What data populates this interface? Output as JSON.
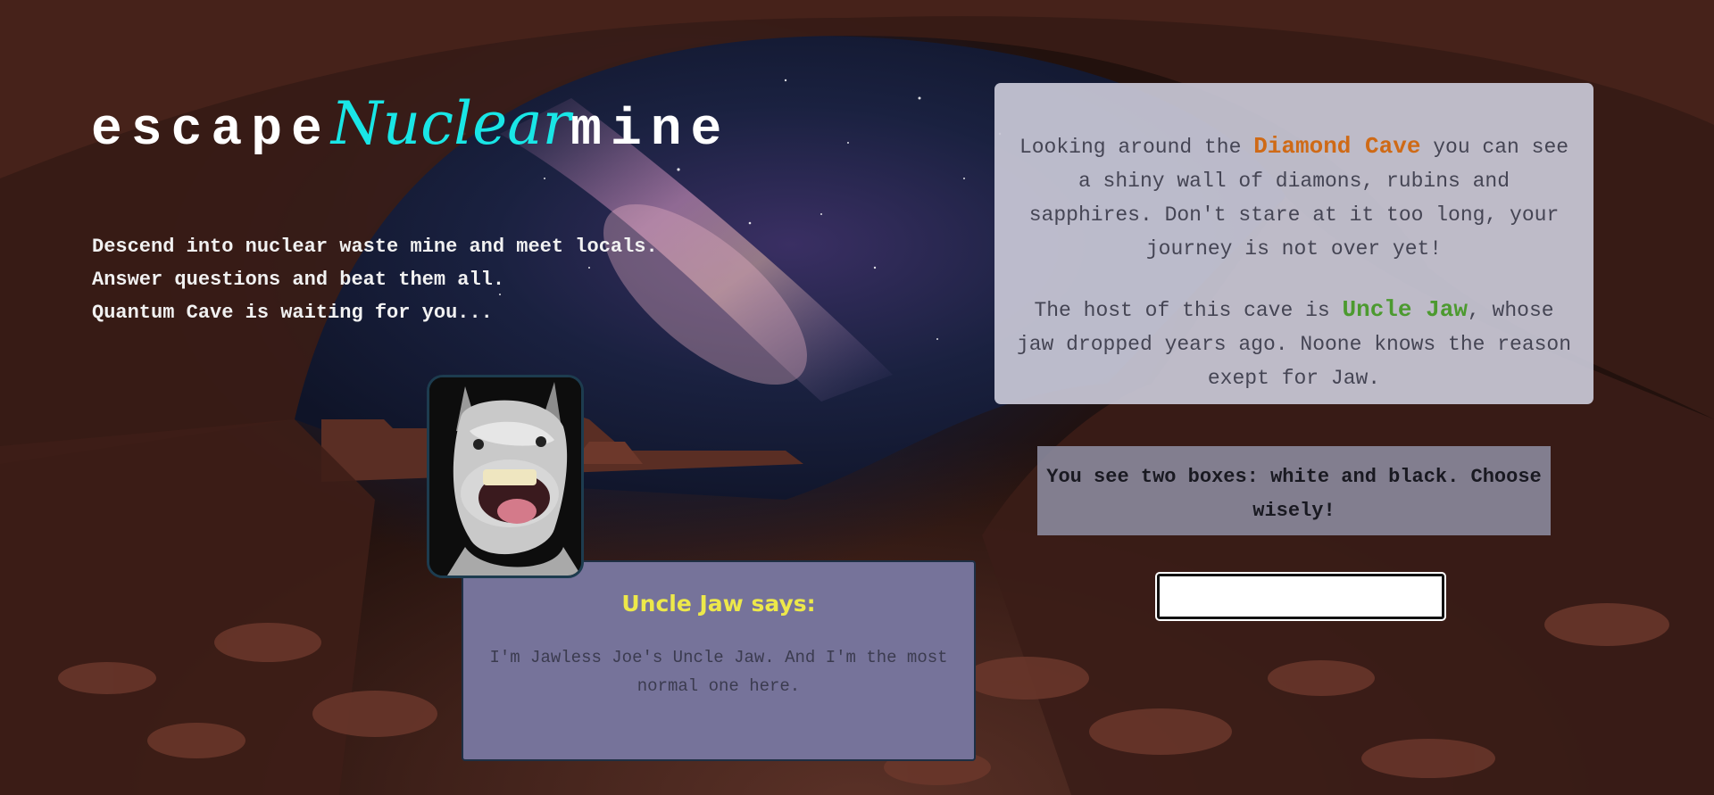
{
  "header": {
    "title_prefix": "escape",
    "title_accent": "Nuclear",
    "title_suffix": "mine"
  },
  "intro": {
    "lines": [
      "Descend into nuclear waste mine and meet locals.",
      "Answer questions and beat them all.",
      "Quantum Cave is waiting for you..."
    ]
  },
  "character": {
    "image": "grinning-donkey-portrait",
    "says_label": "Uncle Jaw says:",
    "quote": "I'm Jawless Joe's Uncle Jaw. And I'm the most normal one here."
  },
  "story": {
    "p1_before": "Looking around the ",
    "location": "Diamond Cave",
    "p1_after": " you can see a shiny wall of diamons, rubins and sapphires. Don't stare at it too long, your journey is not over yet!",
    "p2_before": "The host of this cave is ",
    "host": "Uncle Jaw",
    "p2_after": ", whose jaw dropped years ago. Noone knows the reason exept for Jaw."
  },
  "question": {
    "text": "You see two boxes: white and black. Choose wisely!"
  },
  "answer": {
    "value": "",
    "placeholder": ""
  },
  "colors": {
    "title_accent": "#19e6e6",
    "location_highlight": "#cf6a16",
    "host_highlight": "#4c9a2f",
    "speech_title": "#ede84a"
  }
}
